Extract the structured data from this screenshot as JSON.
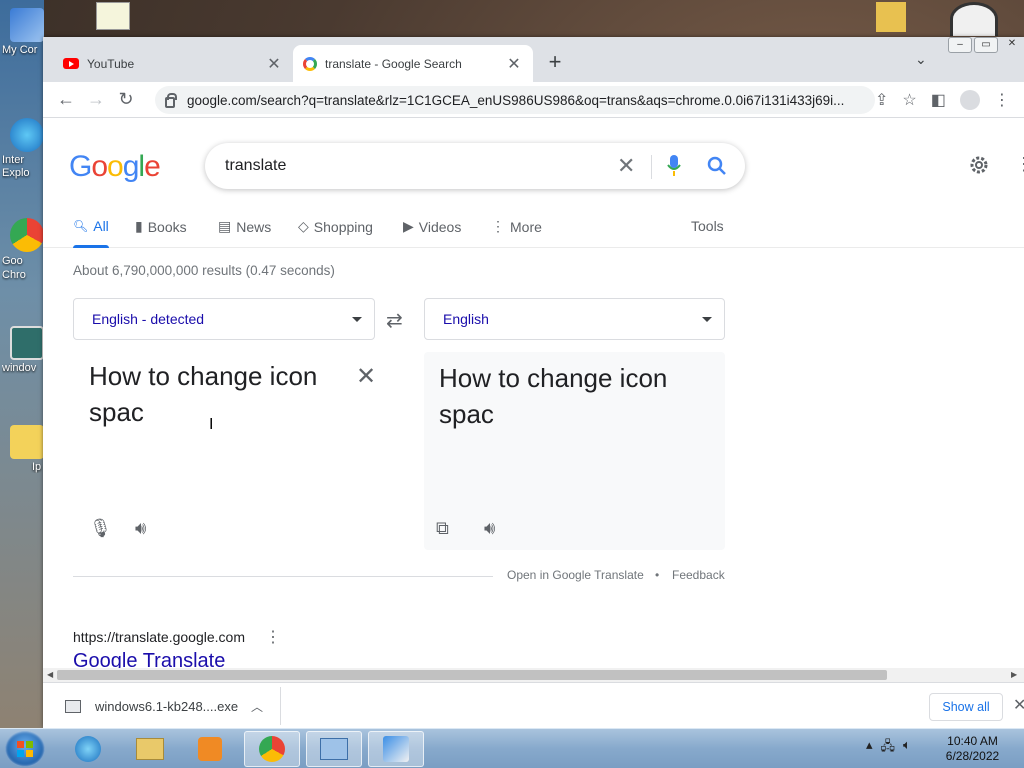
{
  "desktop": {
    "icons": [
      {
        "label": "My Cor"
      },
      {
        "label": "Inter Explo"
      },
      {
        "label": "Goo Chro"
      },
      {
        "label": "windov"
      },
      {
        "label": "Ip"
      }
    ]
  },
  "browser": {
    "tabs": [
      {
        "title": "YouTube",
        "icon": "youtube-icon"
      },
      {
        "title": "translate - Google Search",
        "icon": "google-icon"
      }
    ],
    "url": "google.com/search?q=translate&rlz=1C1GCEA_enUS986US986&oq=trans&aqs=chrome.0.0i67i131i433j69i..."
  },
  "search": {
    "logo": "Google",
    "query": "translate",
    "tabs": [
      "All",
      "Books",
      "News",
      "Shopping",
      "Videos",
      "More"
    ],
    "tools_label": "Tools",
    "result_stats": "About 6,790,000,000 results (0.47 seconds)"
  },
  "translate": {
    "source_lang": "English - detected",
    "target_lang": "English",
    "source_text": "How to change icon spac",
    "target_text": "How to change icon spac",
    "open_link": "Open in Google Translate",
    "separator": "•",
    "feedback": "Feedback"
  },
  "result": {
    "url": "https://translate.google.com",
    "title": "Google Translate"
  },
  "downloads": {
    "file": "windows6.1-kb248....exe",
    "show_all": "Show all"
  },
  "taskbar": {
    "time": "10:40 AM",
    "date": "6/28/2022"
  },
  "colors": {
    "google_blue": "#4285f4",
    "google_red": "#ea4335",
    "google_yellow": "#fbbc05",
    "google_green": "#34a853",
    "link": "#1a0dab",
    "accent": "#1a73e8"
  }
}
